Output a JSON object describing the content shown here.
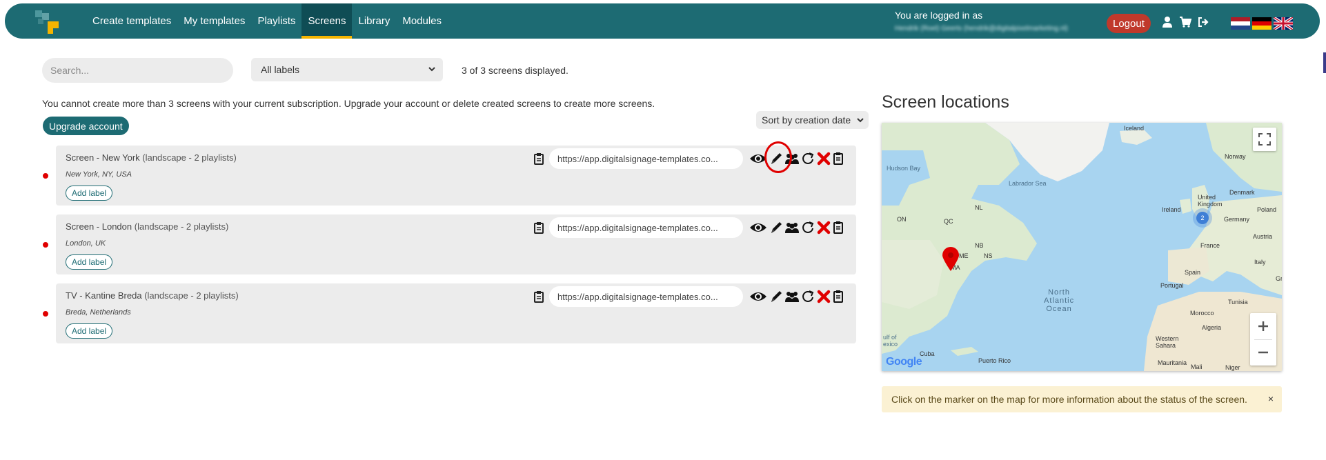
{
  "navbar": {
    "items": [
      {
        "label": "Create templates"
      },
      {
        "label": "My templates"
      },
      {
        "label": "Playlists"
      },
      {
        "label": "Screens",
        "active": true
      },
      {
        "label": "Library"
      },
      {
        "label": "Modules"
      }
    ],
    "login_label": "You are logged in as",
    "login_user": "Hendrik (Roel) Geerts (hendrik@digitalpixelmarketing.nl)",
    "logout_label": "Logout",
    "icons": [
      "user-icon",
      "cart-icon",
      "sign-out-icon"
    ],
    "flags": [
      "flag-nl",
      "flag-de",
      "flag-uk"
    ],
    "accent_color": "#1d6b73",
    "active_indicator_color": "#f5b400"
  },
  "toolbar": {
    "search_placeholder": "Search...",
    "label_filter": "All labels",
    "count_text": "3 of 3 screens displayed."
  },
  "notice": {
    "text": "You cannot create more than 3 screens with your current subscription. Upgrade your account or delete created screens to create more screens.",
    "upgrade_label": "Upgrade account"
  },
  "sort": {
    "label": "Sort by creation date"
  },
  "screens": [
    {
      "name": "Screen -  New York",
      "meta": "(landscape - 2 playlists)",
      "location": "New York,  NY, USA",
      "add_label": "Add label",
      "url": "https://app.digitalsignage-templates.co..."
    },
    {
      "name": "Screen -  London",
      "meta": "(landscape - 2 playlists)",
      "location": "London, UK",
      "add_label": "Add label",
      "url": "https://app.digitalsignage-templates.co..."
    },
    {
      "name": "TV -  Kantine  Breda",
      "meta": "(landscape - 2 playlists)",
      "location": "Breda,  Netherlands",
      "add_label": "Add label",
      "url": "https://app.digitalsignage-templates.co..."
    }
  ],
  "status_color": "#e00000",
  "map": {
    "heading": "Screen locations",
    "cluster_count": "2",
    "labels": {
      "iceland": "Iceland",
      "norway": "Norway",
      "hudson_bay": "Hudson Bay",
      "labrador_sea": "Labrador Sea",
      "denmark": "Denmark",
      "united_kingdom": "United\nKingdom",
      "ireland": "Ireland",
      "poland": "Poland",
      "germany": "Germany",
      "austria": "Austria",
      "france": "France",
      "italy": "Italy",
      "spain": "Spain",
      "portugal": "Portugal",
      "north_atlantic": "North\nAtlantic\nOcean",
      "tunisia": "Tunisia",
      "morocco": "Morocco",
      "algeria": "Algeria",
      "western_sahara": "Western\nSahara",
      "mauritania": "Mauritania",
      "mali": "Mali",
      "niger": "Niger",
      "cuba": "Cuba",
      "puerto_rico": "Puerto Rico",
      "gulf_of_mexico": "ulf of\nexico",
      "on": "ON",
      "qc": "QC",
      "nl": "NL",
      "nb": "NB",
      "me": "ME",
      "ma": "MA",
      "ns": "NS",
      "gre": "Gre",
      "google": "Google"
    },
    "alert": "Click on the marker on the map for more information about the status of the screen.",
    "alert_close": "×"
  }
}
